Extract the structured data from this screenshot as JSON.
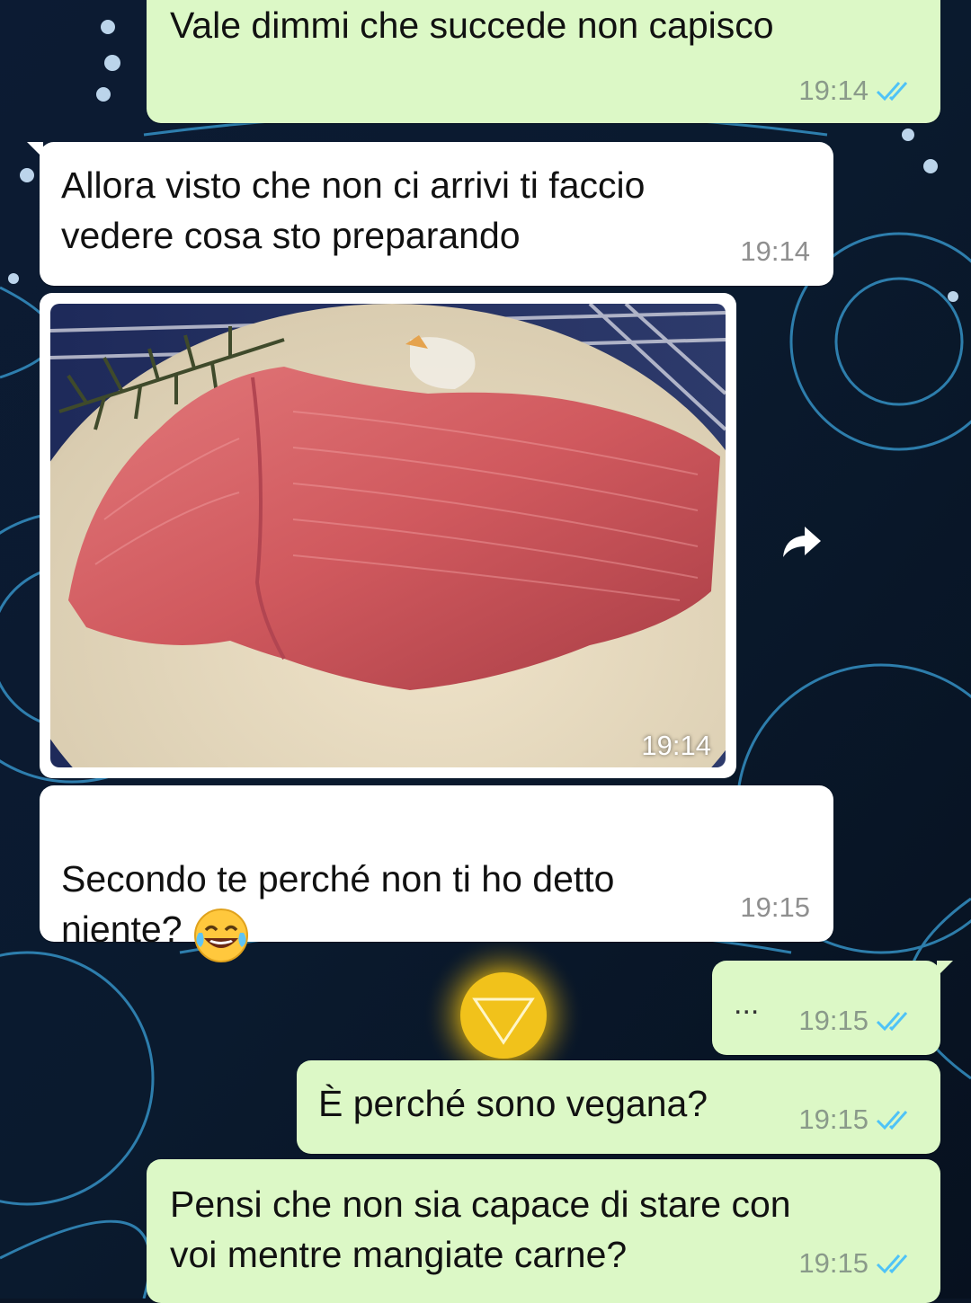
{
  "messages": [
    {
      "id": "m1",
      "direction": "out",
      "text": "Vale dimmi che succede non capisco",
      "time": "19:14",
      "status": "read"
    },
    {
      "id": "m2",
      "direction": "in",
      "text": "Allora visto che non ci arrivi ti faccio\nvedere cosa sto preparando",
      "time": "19:14"
    },
    {
      "id": "m3",
      "direction": "in",
      "type": "image",
      "image_desc": "raw beef steak on a white plate with rosemary",
      "time": "19:14"
    },
    {
      "id": "m4",
      "direction": "in",
      "text": "Secondo te perché non ti ho detto\nniente?",
      "emoji": "face-with-tears-of-joy",
      "time": "19:15"
    },
    {
      "id": "m5",
      "direction": "out",
      "text": "...",
      "time": "19:15",
      "status": "read"
    },
    {
      "id": "m6",
      "direction": "out",
      "text": "È perché sono vegana?",
      "time": "19:15",
      "status": "read"
    },
    {
      "id": "m7",
      "direction": "out",
      "text": "Pensi che non sia capace di stare con\nvoi mentre mangiate carne?",
      "time": "19:15",
      "status": "read"
    }
  ],
  "colors": {
    "outgoing_bubble": "#dcf8c6",
    "incoming_bubble": "#ffffff",
    "read_ticks": "#4fc3f7",
    "wallpaper": "#0a1526"
  },
  "icons": {
    "forward": "forward-arrow-icon",
    "read_status": "double-check-icon"
  }
}
